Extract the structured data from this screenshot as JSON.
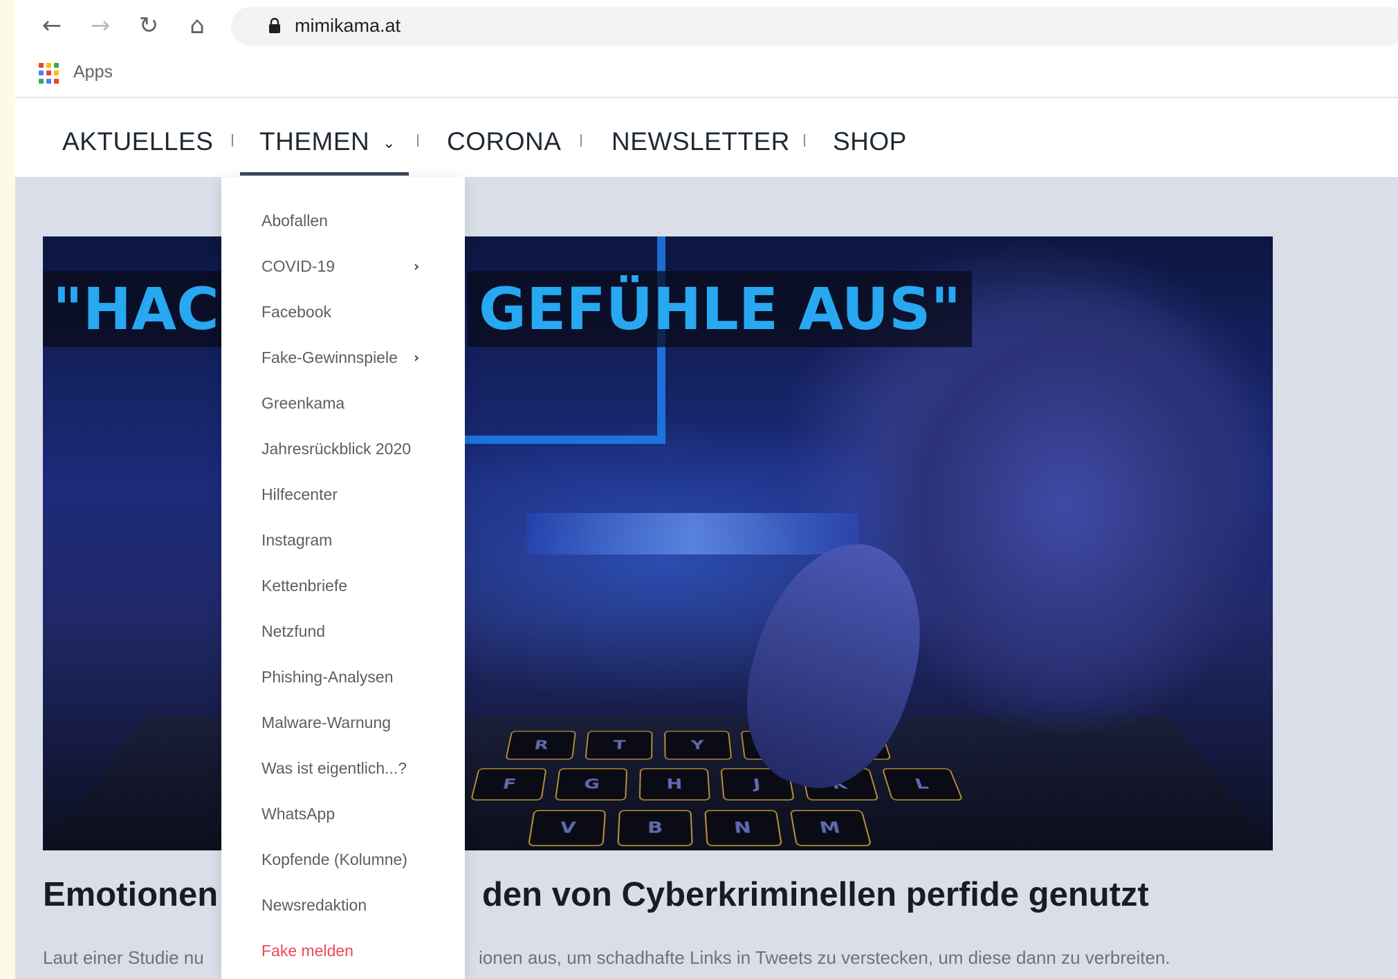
{
  "browser": {
    "url": "mimikama.at",
    "bookmarks": {
      "apps_label": "Apps"
    },
    "apps_icon_colors": [
      "#ea4335",
      "#fbbc05",
      "#34a853",
      "#4285f4",
      "#ea4335",
      "#fbbc05",
      "#34a853",
      "#4285f4",
      "#ea4335"
    ]
  },
  "site_nav": {
    "items": [
      {
        "label": "AKTUELLES"
      },
      {
        "label": "THEMEN",
        "active": true,
        "has_dropdown": true
      },
      {
        "label": "CORONA"
      },
      {
        "label": "NEWSLETTER"
      },
      {
        "label": "SHOP"
      }
    ]
  },
  "dropdown": {
    "items": [
      {
        "label": "Abofallen"
      },
      {
        "label": "COVID-19",
        "has_submenu": true
      },
      {
        "label": "Facebook"
      },
      {
        "label": "Fake-Gewinnspiele",
        "has_submenu": true
      },
      {
        "label": "Greenkama"
      },
      {
        "label": "Jahresrückblick 2020"
      },
      {
        "label": "Hilfecenter"
      },
      {
        "label": "Instagram"
      },
      {
        "label": "Kettenbriefe"
      },
      {
        "label": "Netzfund"
      },
      {
        "label": "Phishing-Analysen"
      },
      {
        "label": "Malware-Warnung"
      },
      {
        "label": "Was ist eigentlich...?"
      },
      {
        "label": "WhatsApp"
      },
      {
        "label": "Kopfende (Kolumne)"
      },
      {
        "label": "Newsredaktion"
      },
      {
        "label": "Fake melden",
        "highlight_color": "#f0475a"
      }
    ]
  },
  "article": {
    "image_headline_left": "\"HACKE",
    "image_headline_right": "GEFÜHLE AUS\"",
    "title_left": "Emotionen",
    "title_right": "den von Cyberkriminellen perfide genutzt",
    "excerpt_left": "Laut einer Studie nu",
    "excerpt_right": "ionen aus, um schadhafte Links in Tweets zu verstecken, um diese dann zu verbreiten."
  },
  "colors": {
    "nav_text": "#1f2933",
    "page_background": "#d9dee9",
    "headline_blue": "#27a8f0",
    "alert_red": "#f0475a"
  }
}
